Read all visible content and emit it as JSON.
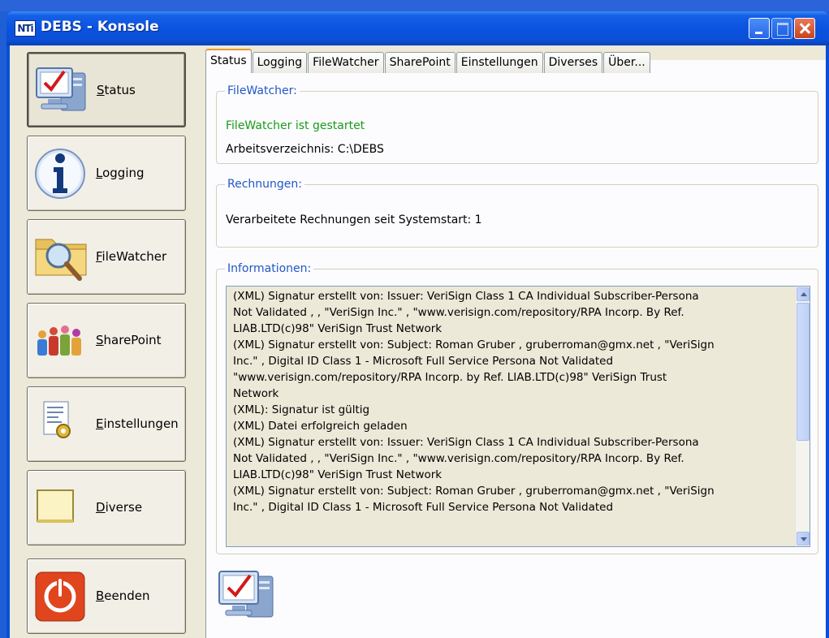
{
  "window": {
    "app_icon": "NTi",
    "title": "DEBS - Konsole"
  },
  "titlebar_buttons": {
    "minimize_icon": "minimize-icon",
    "maximize_icon": "maximize-icon",
    "close_icon": "close-icon"
  },
  "nav": [
    {
      "label_pre": "",
      "accel": "S",
      "label_post": "tatus",
      "icon": "monitor-check-icon",
      "active": true
    },
    {
      "label_pre": "",
      "accel": "L",
      "label_post": "ogging",
      "icon": "info-icon",
      "active": false
    },
    {
      "label_pre": "",
      "accel": "F",
      "label_post": "ileWatcher",
      "icon": "folder-search-icon",
      "active": false
    },
    {
      "label_pre": "",
      "accel": "S",
      "label_post": "harePoint",
      "icon": "people-icon",
      "active": false
    },
    {
      "label_pre": "",
      "accel": "E",
      "label_post": "instellungen",
      "icon": "settings-document-icon",
      "active": false
    },
    {
      "label_pre": "",
      "accel": "D",
      "label_post": "iverse",
      "icon": "note-icon",
      "active": false
    },
    {
      "label_pre": "",
      "accel": "B",
      "label_post": "eenden",
      "icon": "power-icon",
      "active": false
    }
  ],
  "tabs": [
    "Status",
    "Logging",
    "FileWatcher",
    "SharePoint",
    "Einstellungen",
    "Diverses",
    "Über..."
  ],
  "filewatcher": {
    "legend": "FileWatcher:",
    "status": "FileWatcher ist gestartet",
    "workdir": "Arbeitsverzeichnis: C:\\DEBS"
  },
  "rechnungen": {
    "legend": "Rechnungen:",
    "count_text": "Verarbeitete Rechnungen seit Systemstart: 1"
  },
  "informationen": {
    "legend": "Informationen:",
    "lines": [
      "(XML) Signatur erstellt von: Issuer:  VeriSign Class 1 CA Individual Subscriber-Persona",
      "Not Validated , , \"VeriSign  Inc.\" , \"www.verisign.com/repository/RPA Incorp. By Ref.",
      "LIAB.LTD(c)98\" VeriSign Trust Network",
      "(XML) Signatur erstellt von: Subject: Roman Gruber , gruberroman@gmx.net , \"VeriSign",
      " Inc.\" , Digital ID Class 1 - Microsoft Full Service Persona Not Validated",
      "\"www.verisign.com/repository/RPA Incorp. by Ref. LIAB.LTD(c)98\" VeriSign Trust",
      "Network",
      "(XML): Signatur ist gültig",
      "(XML) Datei erfolgreich geladen",
      "(XML) Signatur erstellt von: Issuer:  VeriSign Class 1 CA Individual Subscriber-Persona",
      "Not Validated , , \"VeriSign  Inc.\" , \"www.verisign.com/repository/RPA Incorp. By Ref.",
      "LIAB.LTD(c)98\" VeriSign Trust Network",
      "(XML) Signatur erstellt von: Subject: Roman Gruber , gruberroman@gmx.net , \"VeriSign",
      " Inc.\" , Digital ID Class 1 - Microsoft Full Service Persona Not Validated"
    ]
  },
  "colors": {
    "titlebar": "#0a53e0",
    "legend": "#2157c7",
    "status_green": "#1a9b1a",
    "tab_active_accent": "#e69a2e"
  }
}
